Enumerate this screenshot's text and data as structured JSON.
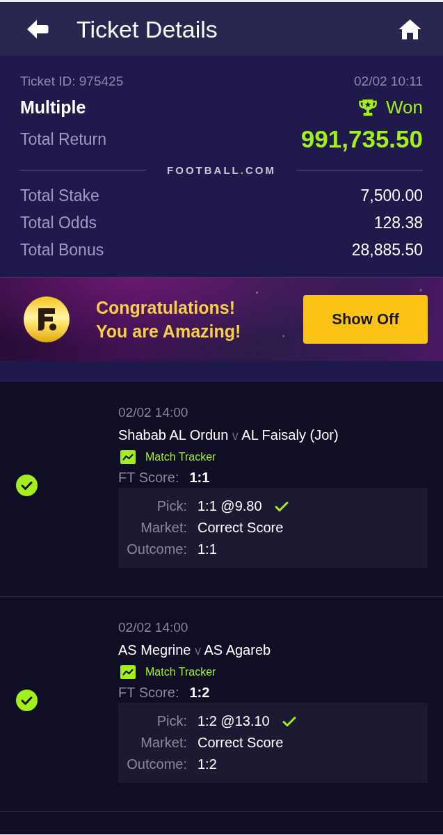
{
  "header": {
    "title": "Ticket Details"
  },
  "summary": {
    "ticket_id": "Ticket ID: 975425",
    "placed_at": "02/02 10:11",
    "bet_type": "Multiple",
    "result": {
      "kind": "won",
      "label": "Won"
    },
    "total_return": {
      "label": "Total Return",
      "value": "991,735.50"
    },
    "brand": {
      "name": "FOOTBALL",
      "dot": ".",
      "domain": "COM"
    },
    "totals": [
      {
        "label": "Total Stake",
        "value": "7,500.00"
      },
      {
        "label": "Total Odds",
        "value": "128.38"
      },
      {
        "label": "Total Bonus",
        "value": "28,885.50"
      }
    ]
  },
  "banner": {
    "message_lines": [
      "Congratulations!",
      "You are Amazing!"
    ],
    "button": "Show Off"
  },
  "selections": [
    {
      "won": true,
      "kick_off": "02/02 14:00",
      "home": "Shabab AL Ordun",
      "versus": "v",
      "away": "AL Faisaly (Jor)",
      "tracker": "Match Tracker",
      "score_label": "FT Score:",
      "score": "1:1",
      "pick": {
        "label": "Pick:",
        "value": "1:1 @9.80",
        "correct": true
      },
      "market": {
        "label": "Market:",
        "value": "Correct Score"
      },
      "outcome": {
        "label": "Outcome:",
        "value": "1:1"
      }
    },
    {
      "won": true,
      "kick_off": "02/02 14:00",
      "home": "AS Megrine",
      "versus": "v",
      "away": "AS Agareb",
      "tracker": "Match Tracker",
      "score_label": "FT Score:",
      "score": "1:2",
      "pick": {
        "label": "Pick:",
        "value": "1:2 @13.10",
        "correct": true
      },
      "market": {
        "label": "Market:",
        "value": "Correct Score"
      },
      "outcome": {
        "label": "Outcome:",
        "value": "1:2"
      }
    }
  ]
}
